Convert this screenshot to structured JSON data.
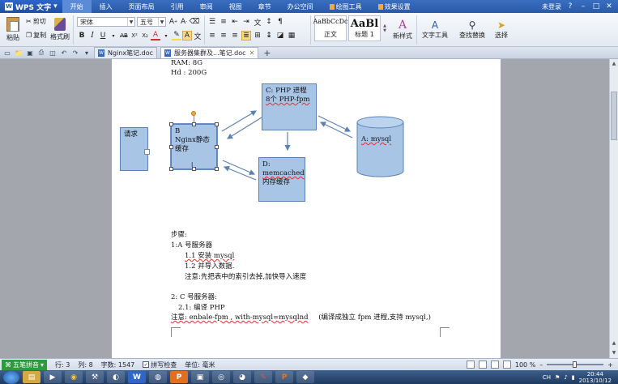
{
  "app": {
    "title": "WPS 文字",
    "menu_tabs": [
      "开始",
      "插入",
      "页面布局",
      "引用",
      "审阅",
      "视图",
      "章节",
      "办公空间"
    ],
    "tool_tabs": [
      "绘图工具",
      "效果设置"
    ],
    "login": "未登录"
  },
  "ribbon": {
    "paste": "粘贴",
    "cut": "剪切",
    "copy": "复制",
    "format_painter": "格式刷",
    "font_name": "宋体",
    "font_size": "五号",
    "styles": [
      {
        "sample": "AaBbCcDc",
        "name": "正文"
      },
      {
        "sample": "AaBl",
        "name": "标题 1"
      }
    ],
    "new_style": "新样式",
    "text_tools": "文字工具",
    "find_replace": "查找替换",
    "select": "选择"
  },
  "doc_tabs": [
    {
      "label": "Nginx笔记.doc",
      "active": false
    },
    {
      "label": "服务器集群及...笔记.doc",
      "active": true
    }
  ],
  "document": {
    "ram": "RAM: 8G",
    "hd": "Hd   : 200G",
    "diagram": {
      "request": "请求",
      "b_label": "B",
      "b_text1": "Nginx静态",
      "b_text2": "缓存",
      "c_text1": "C: PHP 进程",
      "c_text2": "8个 PHP-fpm",
      "d_text1": "D:",
      "d_text2": "memcached",
      "d_text3": "内存缓存",
      "a_text": "A: mysql"
    },
    "steps_title": "步骤:",
    "step1": "1:A 号服务器",
    "step1_1": "1.1 安装  mysql",
    "step1_2": "1.2 并导入数据.",
    "step1_note": "注意:先把表中的索引去掉,加快导入速度",
    "step2": "2: C 号服务器:",
    "step2_1": "2.1: 编译 PHP",
    "step2_note_a": "注意: enbale-fpm , with-mysql=mysqlnd",
    "step2_note_b": "(编译成独立 fpm 进程,支持 mysql,)"
  },
  "status": {
    "ime": "五笔拼音",
    "line": "行: 3",
    "column": "列: 8",
    "word_count": "字数: 1547",
    "spell_check": "拼写检查",
    "unit": "单位: 毫米",
    "zoom": "100 %",
    "zoom_level": 0.5
  },
  "taskbar": {
    "time": "20:44",
    "date": "2013/10/12",
    "lang": "CH"
  }
}
